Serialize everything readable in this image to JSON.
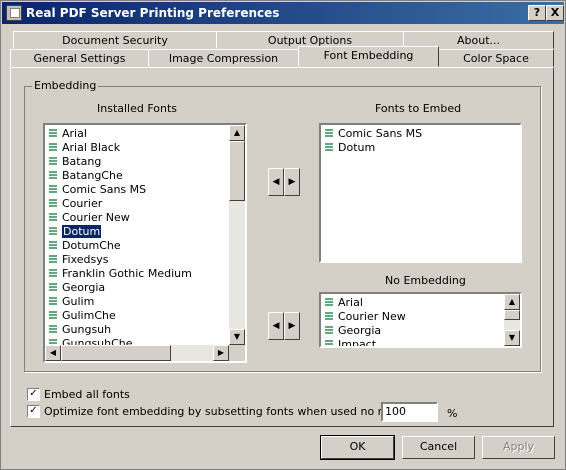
{
  "window": {
    "title": "Real PDF Server Printing Preferences",
    "help_btn": "?",
    "close_btn": "X"
  },
  "tabs": {
    "row1": [
      "Document Security",
      "Output Options",
      "About..."
    ],
    "row2": [
      "General Settings",
      "Image Compression",
      "Font Embedding",
      "Color Space"
    ],
    "active": "Font Embedding"
  },
  "embedding": {
    "group_label": "Embedding",
    "installed_title": "Installed Fonts",
    "installed_fonts": [
      "Arial",
      "Arial Black",
      "Batang",
      "BatangChe",
      "Comic Sans MS",
      "Courier",
      "Courier New",
      "Dotum",
      "DotumChe",
      "Fixedsys",
      "Franklin Gothic Medium",
      "Georgia",
      "Gulim",
      "GulimChe",
      "Gungsuh",
      "GungsuhChe"
    ],
    "selected_font": "Dotum",
    "embed_title": "Fonts to Embed",
    "embed_fonts": [
      "Comic Sans MS",
      "Dotum"
    ],
    "no_embed_title": "No Embedding",
    "no_embed_fonts": [
      "Arial",
      "Courier New",
      "Georgia",
      "Impact"
    ]
  },
  "options": {
    "embed_all_label": "Embed all fonts",
    "embed_all_checked": true,
    "optimize_label": "Optimize font embedding by subsetting fonts when used no more than",
    "optimize_checked": true,
    "threshold_value": "100",
    "threshold_unit": "%"
  },
  "buttons": {
    "ok": "OK",
    "cancel": "Cancel",
    "apply": "Apply"
  },
  "colors": {
    "titlebar_start": "#0a246a",
    "titlebar_end": "#3a6ea5",
    "selection": "#0a246a",
    "font_icon": "#2e8b57"
  }
}
